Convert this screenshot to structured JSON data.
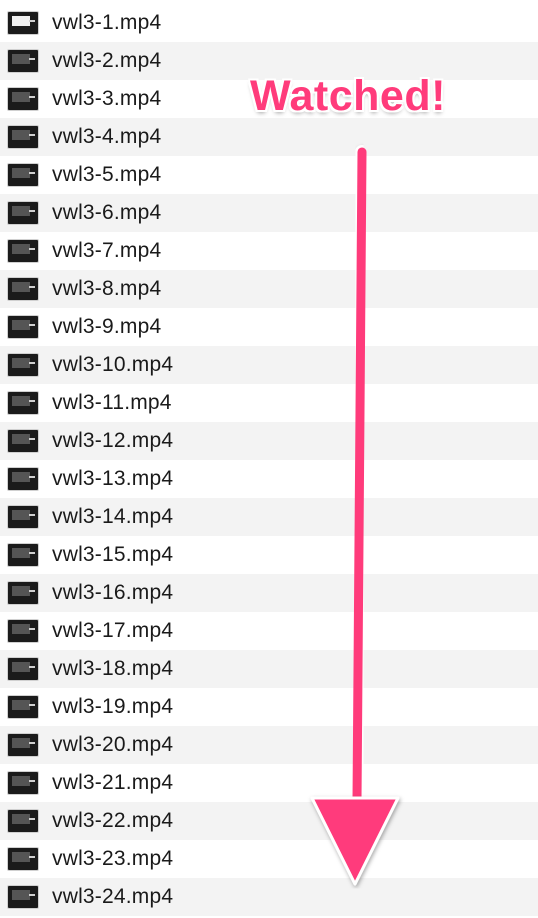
{
  "files": [
    {
      "name": "vwl3-1.mp4"
    },
    {
      "name": "vwl3-2.mp4"
    },
    {
      "name": "vwl3-3.mp4"
    },
    {
      "name": "vwl3-4.mp4"
    },
    {
      "name": "vwl3-5.mp4"
    },
    {
      "name": "vwl3-6.mp4"
    },
    {
      "name": "vwl3-7.mp4"
    },
    {
      "name": "vwl3-8.mp4"
    },
    {
      "name": "vwl3-9.mp4"
    },
    {
      "name": "vwl3-10.mp4"
    },
    {
      "name": "vwl3-11.mp4"
    },
    {
      "name": "vwl3-12.mp4"
    },
    {
      "name": "vwl3-13.mp4"
    },
    {
      "name": "vwl3-14.mp4"
    },
    {
      "name": "vwl3-15.mp4"
    },
    {
      "name": "vwl3-16.mp4"
    },
    {
      "name": "vwl3-17.mp4"
    },
    {
      "name": "vwl3-18.mp4"
    },
    {
      "name": "vwl3-19.mp4"
    },
    {
      "name": "vwl3-20.mp4"
    },
    {
      "name": "vwl3-21.mp4"
    },
    {
      "name": "vwl3-22.mp4"
    },
    {
      "name": "vwl3-23.mp4"
    },
    {
      "name": "vwl3-24.mp4"
    }
  ],
  "annotation": {
    "label": "Watched!",
    "color": "#ff3b7b"
  }
}
